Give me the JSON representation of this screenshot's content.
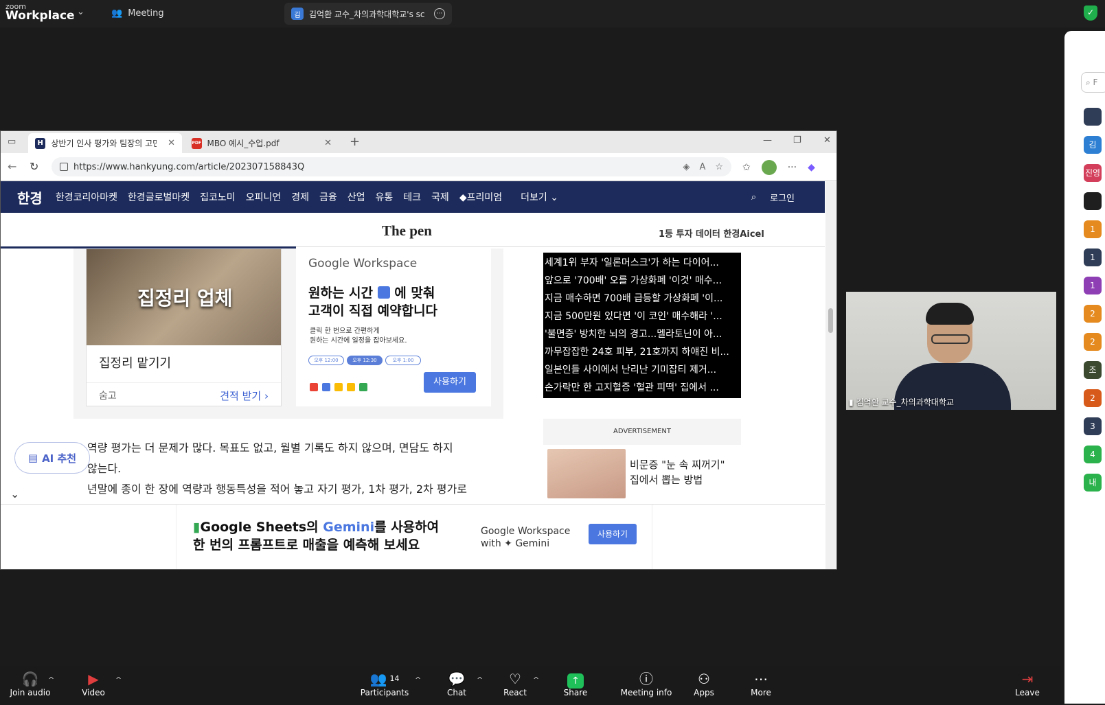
{
  "zoom": {
    "brand_small": "zoom",
    "brand_big": "Workplace",
    "meeting_label": "Meeting",
    "share_tab_badge": "김",
    "share_tab_title": "김억환 교수_차의과학대학교's sc"
  },
  "browser": {
    "tabs": [
      {
        "label": "상반기 인사 평가와 팀장의 고민 |",
        "fav": "H"
      },
      {
        "label": "MBO 예시_수업.pdf",
        "fav": "PDF"
      }
    ],
    "new_tab": "+",
    "url": "https://www.hankyung.com/article/202307158843Q"
  },
  "page": {
    "nav": {
      "logo": "한경",
      "items": [
        "한경코리아마켓",
        "한경글로벌마켓",
        "집코노미",
        "오피니언",
        "경제",
        "금융",
        "산업",
        "유통",
        "테크",
        "국제",
        "프리미엄",
        "더보기"
      ],
      "login": "로그인"
    },
    "sub": {
      "title": "The pen",
      "right": "1등 투자 데이터 한경Aicel"
    },
    "ad1": {
      "image_text": "집정리 업체",
      "title": "집정리 맡기기",
      "footer_left": "숨고",
      "footer_right": "견적 받기 ›"
    },
    "ad2": {
      "brand": "Google Workspace",
      "headline1": "원하는 시간",
      "headline2": "에 맞춰",
      "headline3": "고객이 직접 예약합니다",
      "desc1": "클릭 한 번으로 간편하게",
      "desc2": "원하는 시간에 일정을 잡아보세요.",
      "pills": [
        "오후 12:00",
        "오후 12:30",
        "오후 1:00"
      ],
      "button": "사용하기"
    },
    "news": [
      "세계1위 부자 '일론머스크'가 하는 다이어...",
      "앞으로 '700배' 오를 가상화폐 '이것' 매수...",
      "지금 매수하면 700배 급등할 가상화폐 '이...",
      "지금 500만원 있다면 '이 코인' 매수해라 '...",
      "'불면증' 방치한 뇌의 경고...멜라토닌이 아...",
      "까무잡잡한 24호 피부, 21호까지 하얘진 비...",
      "일본인들 사이에서 난리난 기미잡티 제거...",
      "손가락만 한 고지혈증 '혈관 피떡' 집에서 ..."
    ],
    "advert_label": "ADVERTISEMENT",
    "advert_card": {
      "line1": "비문증 \"눈 속 찌꺼기\"",
      "line2": "집에서 뽑는 방법"
    },
    "ai_button": "AI 추천",
    "article": [
      "역량 평가는 더 문제가 많다. 목표도 없고, 월별 기록도 하지 않으며, 면담도 하지",
      "않는다.",
      "년말에 종이 한 장에 역량과 행동특성을 적어 놓고 자기 평가, 1차 평가, 2차 평가로"
    ],
    "bottom_ad": {
      "line1a": "Google Sheets의 ",
      "line1b": "Gemini",
      "line1c": "를 사용하여",
      "line2": "한 번의 프롬프트로 매출을 예측해 보세요",
      "brand1": "Google Workspace",
      "brand2": "with ✦ Gemini",
      "button": "사용하기"
    }
  },
  "video": {
    "name": "김억환 교수_차의과학대학교"
  },
  "participants_strip": [
    {
      "label": "",
      "color": "#2f3d57"
    },
    {
      "label": "김",
      "color": "#2c7fd3"
    },
    {
      "label": "진영",
      "color": "#d33e5a"
    },
    {
      "label": "",
      "color": "#1f1f1f"
    },
    {
      "label": "1",
      "color": "#e58a1f"
    },
    {
      "label": "1",
      "color": "#2f3d57"
    },
    {
      "label": "1",
      "color": "#8e3fb4"
    },
    {
      "label": "2",
      "color": "#e58a1f"
    },
    {
      "label": "2",
      "color": "#e58a1f"
    },
    {
      "label": "조",
      "color": "#3b4a2f"
    },
    {
      "label": "2",
      "color": "#d85a1a"
    },
    {
      "label": "3",
      "color": "#2f3d57"
    },
    {
      "label": "4",
      "color": "#2bb24c"
    },
    {
      "label": "내",
      "color": "#2bb24c"
    }
  ],
  "toolbar": {
    "join_audio": "Join audio",
    "video": "Video",
    "participants": "Participants",
    "participants_count": "14",
    "chat": "Chat",
    "react": "React",
    "share": "Share",
    "meeting_info": "Meeting info",
    "apps": "Apps",
    "more": "More",
    "leave": "Leave"
  }
}
